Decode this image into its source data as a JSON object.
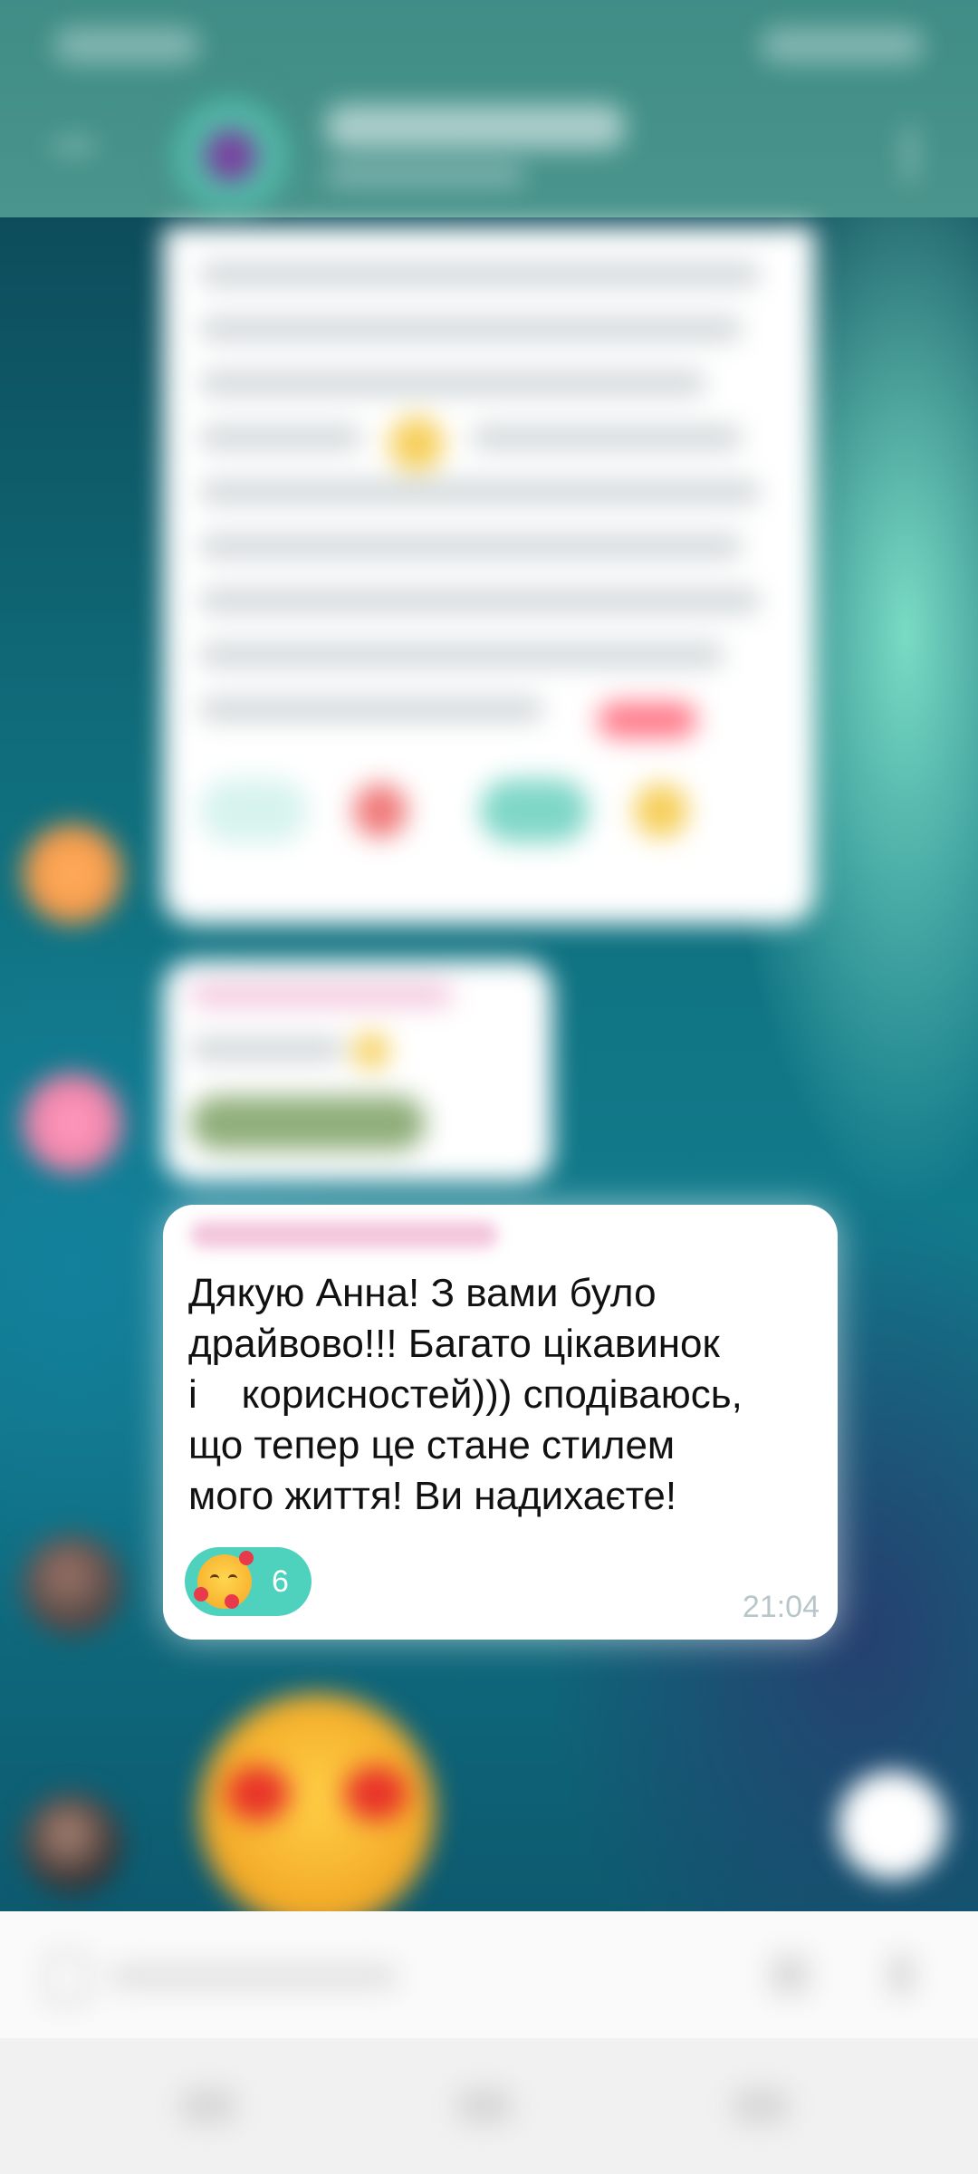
{
  "message": {
    "text": "Дякую Анна! З вами було драйвово!!! Багато цікавинок\nі    корисностей))) сподіваюсь,\nщо тепер це стане стилем\nмого життя! Ви надихаєте!",
    "time": "21:04",
    "reaction": {
      "icon": "smiling-face-with-hearts-icon",
      "count": "6"
    }
  },
  "colors": {
    "header": "#4a958d",
    "reaction_bg": "#4ed2be",
    "bubble_bg": "#ffffff",
    "time_text": "#b8c6c9"
  }
}
